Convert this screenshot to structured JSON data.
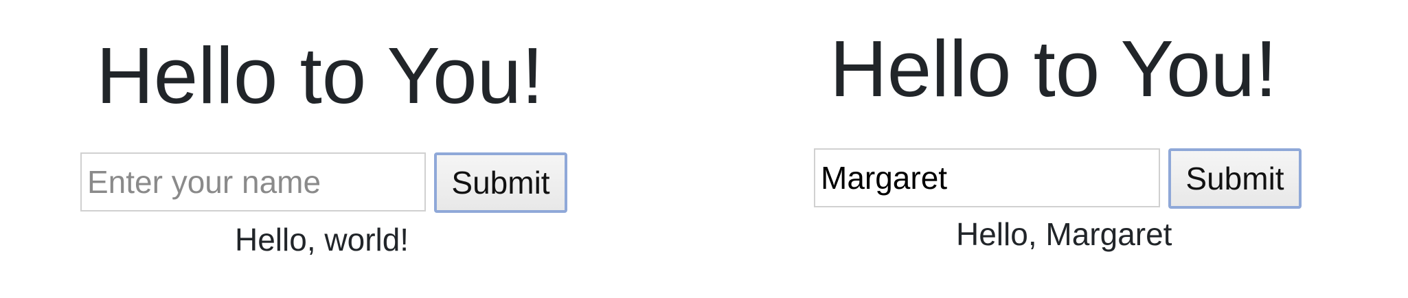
{
  "panels": [
    {
      "title": "Hello to You!",
      "input": {
        "value": "",
        "placeholder": "Enter your name"
      },
      "submit_label": "Submit",
      "greeting": "Hello, world!"
    },
    {
      "title": "Hello to You!",
      "input": {
        "value": "Margaret",
        "placeholder": ""
      },
      "submit_label": "Submit",
      "greeting": "Hello, Margaret"
    }
  ],
  "colors": {
    "text": "#212529",
    "input_border": "#d0d0d0",
    "button_focus_border": "#8fa8d8",
    "placeholder": "#8a8a8a"
  }
}
